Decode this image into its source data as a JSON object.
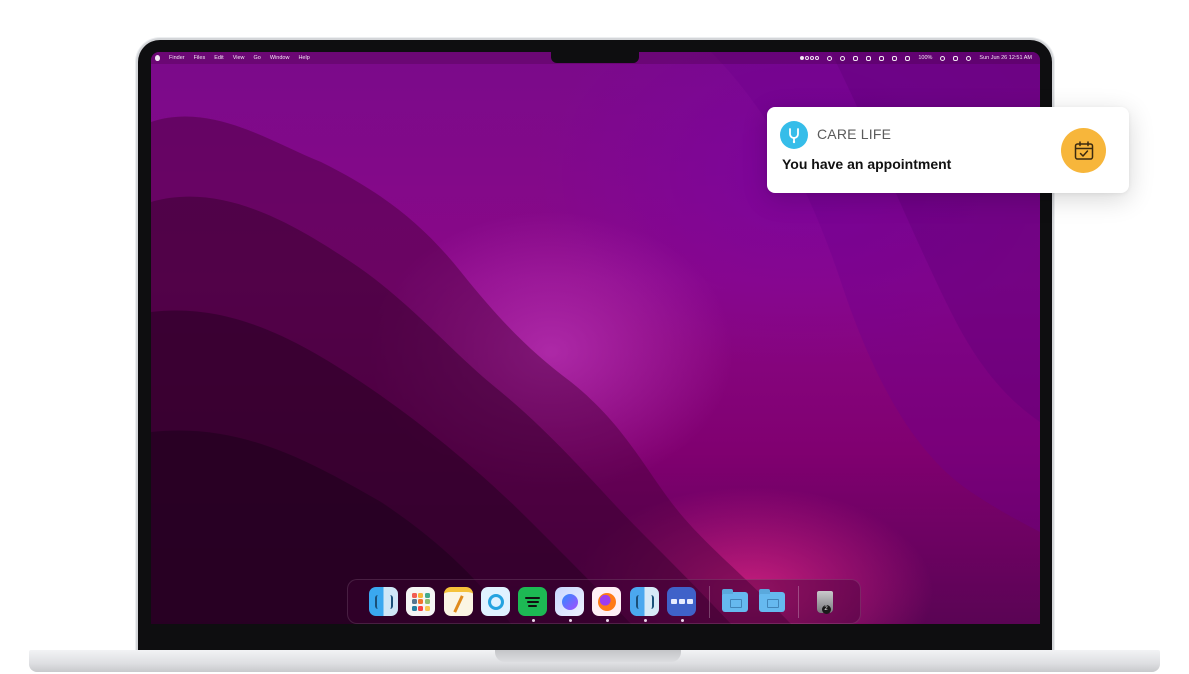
{
  "menubar": {
    "app_menus": [
      "Finder",
      "Files",
      "Edit",
      "View",
      "Go",
      "Window",
      "Help"
    ],
    "battery_text": "100%",
    "clock": "Sun Jun 26  12:51 AM"
  },
  "notification": {
    "app_name": "CARE LIFE",
    "message": "You have an appointment",
    "app_logo_icon": "stethoscope-icon",
    "action_icon": "calendar-check-icon",
    "accent_color": "#f7b63b",
    "logo_color": "#36bde9"
  },
  "dock": {
    "apps": [
      {
        "name": "Finder",
        "icon": "finder-icon",
        "running": false
      },
      {
        "name": "Launchpad",
        "icon": "launchpad-icon",
        "running": false
      },
      {
        "name": "Notes",
        "icon": "notes-icon",
        "running": false
      },
      {
        "name": "QuickTime Player",
        "icon": "quicktime-icon",
        "running": false
      },
      {
        "name": "Spotify",
        "icon": "spotify-icon",
        "running": true
      },
      {
        "name": "Messenger",
        "icon": "messenger-icon",
        "running": true
      },
      {
        "name": "Firefox",
        "icon": "firefox-icon",
        "running": true
      },
      {
        "name": "Finder",
        "icon": "finder-icon",
        "running": true
      },
      {
        "name": "Mission Control",
        "icon": "mission-control-icon",
        "running": true
      }
    ],
    "folders": [
      "folder-icon",
      "folder-icon"
    ],
    "trash_badge": "2"
  }
}
